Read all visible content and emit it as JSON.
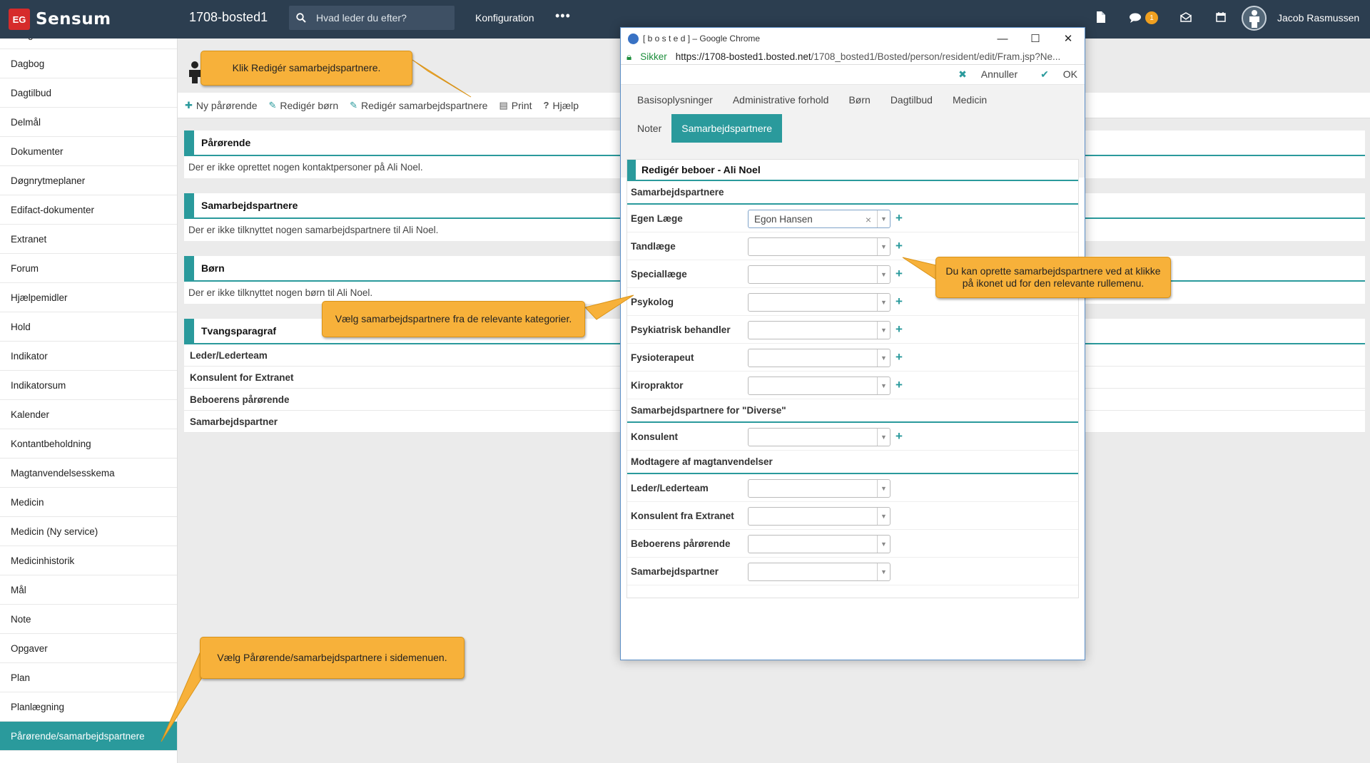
{
  "topbar": {
    "logo_mark": "EG",
    "logo_text": "Sensum",
    "site": "1708-bosted1",
    "search_placeholder": "Hvad leder du efter?",
    "konfiguration": "Konfiguration",
    "more": "•••",
    "notifications_count": "1",
    "user_name": "Jacob Rasmussen"
  },
  "sidebar": {
    "items": [
      "Budget",
      "Dagbog",
      "Dagtilbud",
      "Delmål",
      "Dokumenter",
      "Døgnrytmeplaner",
      "Edifact-dokumenter",
      "Extranet",
      "Forum",
      "Hjælpemidler",
      "Hold",
      "Indikator",
      "Indikatorsum",
      "Kalender",
      "Kontantbeholdning",
      "Magtanvendelsesskema",
      "Medicin",
      "Medicin (Ny service)",
      "Medicinhistorik",
      "Mål",
      "Note",
      "Opgaver",
      "Plan",
      "Planlægning",
      "Pårørende/samarbejdspartnere"
    ],
    "active": "Pårørende/samarbejdspartnere"
  },
  "toolbar": {
    "new_relative": "Ny pårørende",
    "edit_children": "Redigér børn",
    "edit_partners": "Redigér samarbejdspartnere",
    "print": "Print",
    "help": "Hjælp"
  },
  "panels": {
    "parorende": {
      "title": "Pårørende",
      "text": "Der er ikke oprettet nogen kontaktpersoner på Ali Noel."
    },
    "samarbejd": {
      "title": "Samarbejdspartnere",
      "text": "Der er ikke tilknyttet nogen samarbejdspartnere til Ali Noel."
    },
    "born": {
      "title": "Børn",
      "text": "Der er ikke tilknyttet nogen børn til Ali Noel."
    },
    "tvang": {
      "title": "Tvangsparagraf",
      "rows": [
        "Leder/Lederteam",
        "Konsulent for Extranet",
        "Beboerens pårørende",
        "Samarbejdspartner"
      ]
    }
  },
  "popup": {
    "window_title": "[ b o s t e d ] – Google Chrome",
    "secure": "Sikker",
    "url_host": "https://1708-bosted1.bosted.net",
    "url_path": "/1708_bosted1/Bosted/person/resident/edit/Fram.jsp?Ne...",
    "cancel": "Annuller",
    "ok": "OK",
    "tabs_row1": [
      "Basisoplysninger",
      "Administrative forhold",
      "Børn",
      "Dagtilbud",
      "Medicin"
    ],
    "tabs_row2": [
      "Noter",
      "Samarbejdspartnere"
    ],
    "active_tab": "Samarbejdspartnere",
    "card_title": "Redigér beboer - Ali Noel",
    "section1": "Samarbejdspartnere",
    "fields1": [
      {
        "label": "Egen Læge",
        "value": "Egon Hansen"
      },
      {
        "label": "Tandlæge",
        "value": ""
      },
      {
        "label": "Speciallæge",
        "value": ""
      },
      {
        "label": "Psykolog",
        "value": ""
      },
      {
        "label": "Psykiatrisk behandler",
        "value": ""
      },
      {
        "label": "Fysioterapeut",
        "value": ""
      },
      {
        "label": "Kiropraktor",
        "value": ""
      }
    ],
    "section2": "Samarbejdspartnere for \"Diverse\"",
    "fields2": [
      {
        "label": "Konsulent",
        "value": ""
      }
    ],
    "section3": "Modtagere af magtanvendelser",
    "fields3": [
      {
        "label": "Leder/Lederteam",
        "value": ""
      },
      {
        "label": "Konsulent fra Extranet",
        "value": ""
      },
      {
        "label": "Beboerens pårørende",
        "value": ""
      },
      {
        "label": "Samarbejdspartner",
        "value": ""
      }
    ]
  },
  "callouts": {
    "c1": "Klik Redigér samarbejdspartnere.",
    "c2": "Vælg samarbejdspartnere fra de relevante kategorier.",
    "c3": "Du kan oprette samarbejdspartnere ved at klikke på ikonet ud for den relevante rullemenu.",
    "c4": "Vælg Pårørende/samarbejdspartnere i sidemenuen."
  },
  "colors": {
    "accent": "#2a9a9c",
    "topbar": "#2c3e50",
    "callout": "#f7b13a",
    "badge": "#f0a020"
  }
}
